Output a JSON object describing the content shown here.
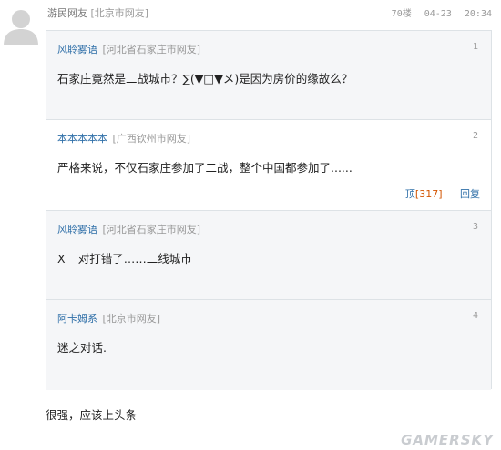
{
  "header": {
    "user": "游民网友",
    "location": "[北京市网友]",
    "floor": "70楼",
    "date": "04-23",
    "time": "20:34"
  },
  "floors": [
    {
      "user": "风聆雾语",
      "location": "[河北省石家庄市网友]",
      "num": "1",
      "content": "石家庄竟然是二战城市？∑(▼□▼メ)是因为房价的缘故么？"
    },
    {
      "user": "本本本本本",
      "location": "[广西钦州市网友]",
      "num": "2",
      "content": "严格来说，不仅石家庄参加了二战，整个中国都参加了......",
      "up_label": "顶",
      "up_count": "[317]",
      "reply_label": "回复"
    },
    {
      "user": "风聆雾语",
      "location": "[河北省石家庄市网友]",
      "num": "3",
      "content": "X _ 对打错了……二线城市"
    },
    {
      "user": "阿卡姆系",
      "location": "[北京市网友]",
      "num": "4",
      "content": "迷之对话."
    }
  ],
  "main_comment": "很强，应该上头条",
  "watermark": "GAMERSKY"
}
